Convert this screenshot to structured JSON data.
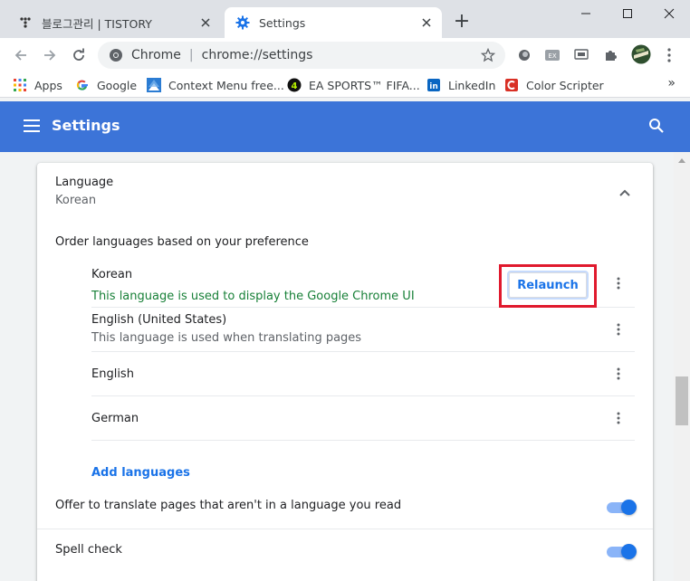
{
  "tabs": [
    {
      "title": "블로그관리 | TISTORY",
      "icon": "tistory-icon",
      "active": false
    },
    {
      "title": "Settings",
      "icon": "gear-icon",
      "active": true
    }
  ],
  "new_tab_label": "+",
  "omnibox": {
    "site_label": "Chrome",
    "separator": "|",
    "url": "chrome://settings"
  },
  "bookmarks": [
    {
      "label": "Apps",
      "icon": "apps-grid-icon"
    },
    {
      "label": "Google",
      "icon": "google-icon"
    },
    {
      "label": "Context Menu free...",
      "icon": "context-menu-icon"
    },
    {
      "label": "EA SPORTS™ FIFA...",
      "icon": "fifa-icon"
    },
    {
      "label": "LinkedIn",
      "icon": "linkedin-icon"
    },
    {
      "label": "Color Scripter",
      "icon": "color-scripter-icon"
    }
  ],
  "bookmarks_more": "»",
  "settings": {
    "title": "Settings",
    "language_section": {
      "title": "Language",
      "current": "Korean",
      "order_label": "Order languages based on your preference",
      "languages": [
        {
          "name": "Korean",
          "note": "This language is used to display the Google Chrome UI",
          "note_color": "#188038"
        },
        {
          "name": "English (United States)",
          "note": "This language is used when translating pages",
          "note_color": "#5f6368"
        },
        {
          "name": "English",
          "note": ""
        },
        {
          "name": "German",
          "note": ""
        }
      ],
      "relaunch_label": "Relaunch",
      "add_languages_label": "Add languages"
    },
    "toggles": [
      {
        "label": "Offer to translate pages that aren't in a language you read",
        "on": true
      },
      {
        "label": "Spell check",
        "on": true
      }
    ]
  },
  "colors": {
    "header_blue": "#3c74d8",
    "link_blue": "#1a73e8",
    "highlight_red": "#e0192d",
    "toggle_knob": "#1a73e8",
    "toggle_track": "#8ab4f8"
  }
}
